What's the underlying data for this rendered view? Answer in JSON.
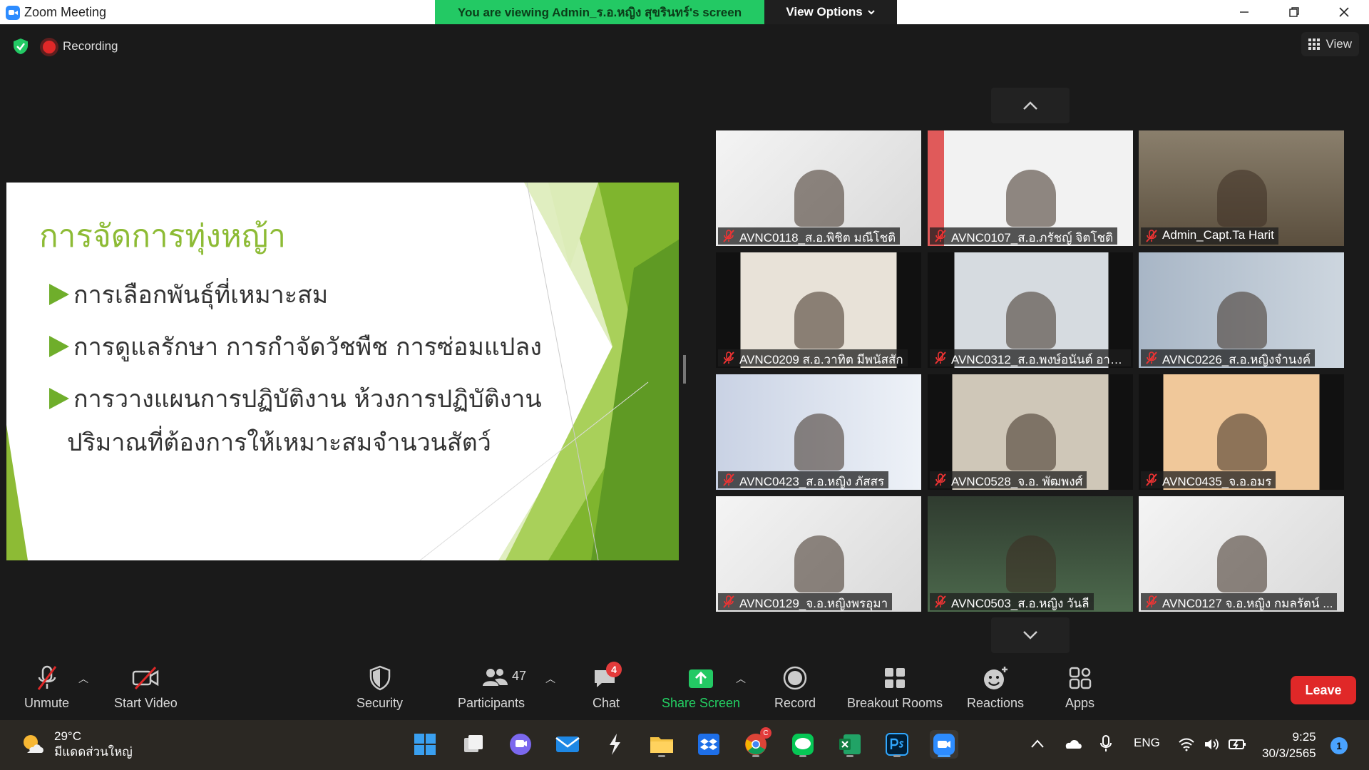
{
  "window": {
    "app_title": "Zoom Meeting",
    "viewing_banner": "You are viewing Admin_ร.อ.หญิง สุขรินทร์'s screen",
    "view_options": "View Options"
  },
  "status": {
    "recording": "Recording",
    "view": "View"
  },
  "slide": {
    "title": "การจัดการทุ่งหญ้า",
    "bullets": [
      "การเลือกพันธุ์ที่เหมาะสม",
      "การดูแลรักษา การกำจัดวัชพืช การซ่อมแปลง",
      "การวางแผนการปฏิบัติงาน ห้วงการปฏิบัติงาน"
    ],
    "bullet3_cont": "ปริมาณที่ต้องการให้เหมาะสมจำนวนสัตว์",
    "accent": "#8dbb35"
  },
  "participants_tiles": [
    {
      "name": "AVNC0118_ส.อ.พิชิต มณีโชติ"
    },
    {
      "name": "AVNC0107_ส.อ.ภรัชญ์ จิตโชติ"
    },
    {
      "name": "Admin_Capt.Ta Harit"
    },
    {
      "name": "AVNC0209 ส.อ.วาทิต มีพนัสสัก"
    },
    {
      "name": "AVNC0312_ส.อ.พงษ์อนันต์ อายุ..."
    },
    {
      "name": "AVNC0226_ส.อ.หญิงจำนงค์"
    },
    {
      "name": "AVNC0423_ส.อ.หญิง ภัสสร"
    },
    {
      "name": "AVNC0528_จ.อ. พัฒพงศ์"
    },
    {
      "name": "AVNC0435_จ.อ.อมร"
    },
    {
      "name": "AVNC0129_จ.อ.หญิงพรอุมา"
    },
    {
      "name": "AVNC0503_ส.อ.หญิง วันลี"
    },
    {
      "name": "AVNC0127 จ.อ.หญิง กมลรัตน์ ..."
    }
  ],
  "toolbar": {
    "unmute": "Unmute",
    "start_video": "Start Video",
    "security": "Security",
    "participants": "Participants",
    "participants_count": "47",
    "chat": "Chat",
    "chat_badge": "4",
    "share_screen": "Share Screen",
    "record": "Record",
    "breakout_rooms": "Breakout Rooms",
    "reactions": "Reactions",
    "apps": "Apps",
    "leave": "Leave"
  },
  "taskbar": {
    "temp": "29°C",
    "weather": "มีแดดส่วนใหญ่",
    "lang": "ENG",
    "time": "9:25",
    "date": "30/3/2565",
    "notifications": "1",
    "chrome_badge": "C"
  },
  "colors": {
    "zoom_blue": "#2d8cff",
    "banner_green": "#23c964",
    "leave_red": "#e02828"
  }
}
